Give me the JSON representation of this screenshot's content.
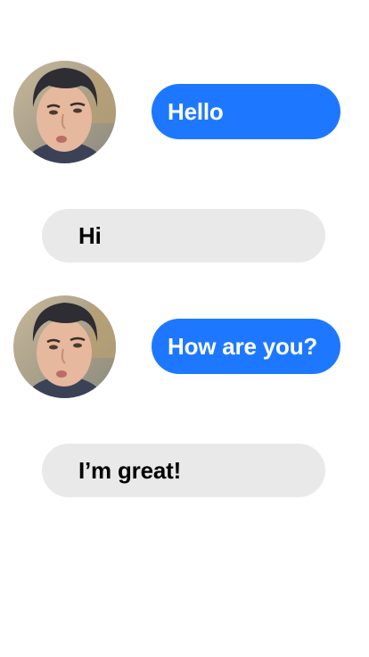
{
  "colors": {
    "sent_bubble": "#1e78ff",
    "received_bubble": "#e9e9e9",
    "sent_text": "#ffffff",
    "received_text": "#000000",
    "background": "#ffffff"
  },
  "conversation": {
    "messages": [
      {
        "sender": "contact",
        "avatar_icon": "user-avatar-icon",
        "text": "Hello"
      },
      {
        "sender": "self",
        "text": "Hi"
      },
      {
        "sender": "contact",
        "avatar_icon": "user-avatar-icon",
        "text": "How are you?"
      },
      {
        "sender": "self",
        "text": "I’m great!"
      }
    ]
  }
}
